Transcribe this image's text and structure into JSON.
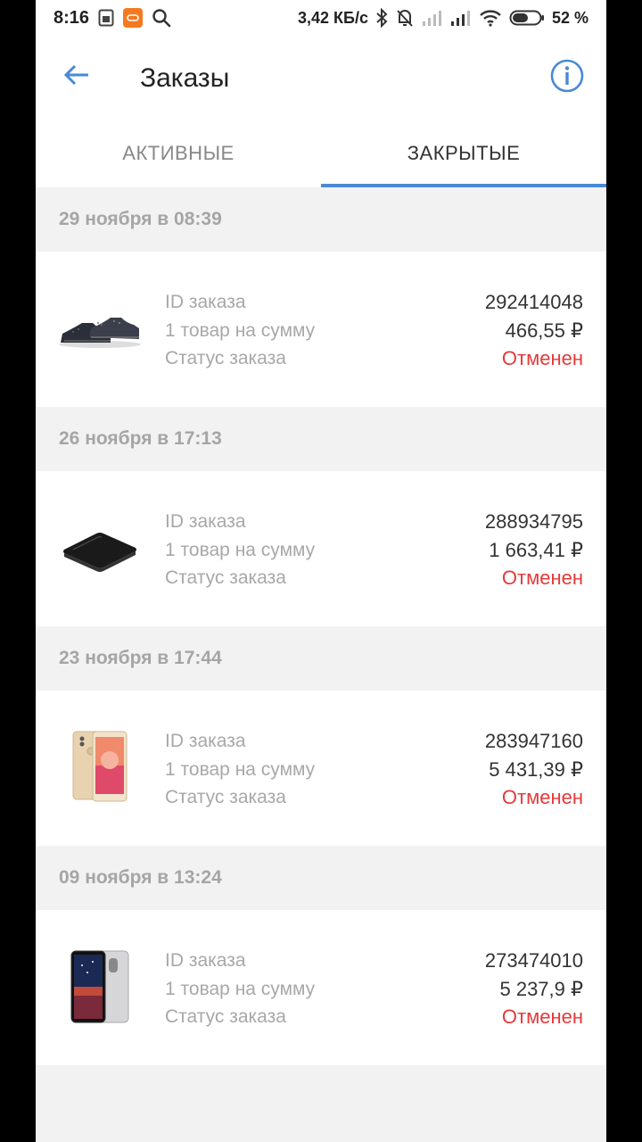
{
  "status_bar": {
    "time": "8:16",
    "speed": "3,42 КБ/с",
    "battery": "52 %"
  },
  "header": {
    "title": "Заказы"
  },
  "tabs": [
    {
      "label": "АКТИВНЫЕ",
      "active": false
    },
    {
      "label": "ЗАКРЫТЫЕ",
      "active": true
    }
  ],
  "labels": {
    "id": "ID заказа",
    "sum": "1 товар на сумму",
    "status": "Статус заказа"
  },
  "orders": [
    {
      "date": "29 ноября в 08:39",
      "id": "292414048",
      "sum": "466,55 ₽",
      "status": "Отменен",
      "product_icon": "sneakers-image"
    },
    {
      "date": "26 ноября в 17:13",
      "id": "288934795",
      "sum": "1 663,41 ₽",
      "status": "Отменен",
      "product_icon": "tv-box-image"
    },
    {
      "date": "23 ноября в 17:44",
      "id": "283947160",
      "sum": "5 431,39 ₽",
      "status": "Отменен",
      "product_icon": "gold-phone-image"
    },
    {
      "date": "09 ноября в 13:24",
      "id": "273474010",
      "sum": "5 237,9 ₽",
      "status": "Отменен",
      "product_icon": "dark-phone-image"
    }
  ],
  "colors": {
    "accent": "#4a8ad4",
    "status_cancelled": "#e53939",
    "background": "#f2f2f2"
  }
}
